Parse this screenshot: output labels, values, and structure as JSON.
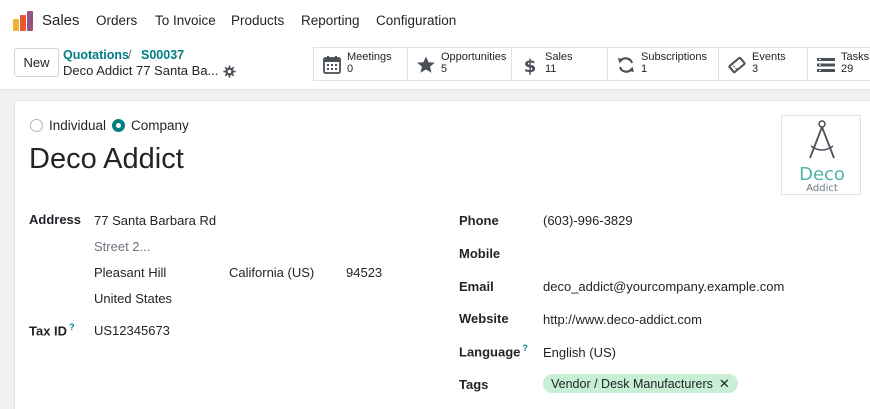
{
  "nav": {
    "app_name": "Sales",
    "menu": [
      "Orders",
      "To Invoice",
      "Products",
      "Reporting",
      "Configuration"
    ]
  },
  "control": {
    "new_label": "New",
    "breadcrumb": [
      "Quotations",
      "S00037"
    ],
    "breadcrumb_sep": "/",
    "record_name": "Deco Addict 77 Santa Ba..."
  },
  "smart_buttons": [
    {
      "label": "Meetings",
      "count": "0",
      "icon": "calendar-icon"
    },
    {
      "label": "Opportunities",
      "count": "5",
      "icon": "star-icon"
    },
    {
      "label": "Sales",
      "count": "11",
      "icon": "dollar-icon"
    },
    {
      "label": "Subscriptions",
      "count": "1",
      "icon": "refresh-icon"
    },
    {
      "label": "Events",
      "count": "3",
      "icon": "ticket-icon"
    },
    {
      "label": "Tasks",
      "count": "29",
      "icon": "tasks-icon"
    }
  ],
  "form": {
    "type_options": [
      "Individual",
      "Company"
    ],
    "type_selected": "Company",
    "name": "Deco Addict",
    "logo": {
      "line1": "Deco",
      "line2": "Addict"
    },
    "address_label": "Address",
    "street": "77 Santa Barbara Rd",
    "street2_placeholder": "Street 2...",
    "city": "Pleasant Hill",
    "state": "California (US)",
    "zip": "94523",
    "country": "United States",
    "tax_label": "Tax ID",
    "tax_help": "?",
    "tax_id": "US12345673",
    "phone_label": "Phone",
    "phone": "(603)-996-3829",
    "mobile_label": "Mobile",
    "email_label": "Email",
    "email": "deco_addict@yourcompany.example.com",
    "website_label": "Website",
    "website": "http://www.deco-addict.com",
    "language_label": "Language",
    "language_help": "?",
    "language": "English (US)",
    "tags_label": "Tags",
    "tags": [
      "Vendor / Desk Manufacturers"
    ],
    "tag_remove": "✕"
  },
  "colors": {
    "accent": "#017e84",
    "tag_bg": "#c8efd3",
    "logo_teal": "#4fb6a8"
  }
}
